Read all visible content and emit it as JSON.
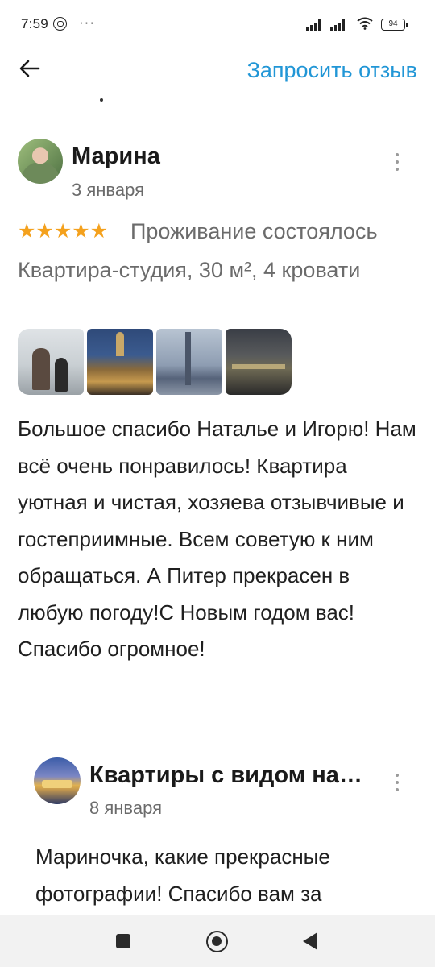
{
  "status_bar": {
    "time": "7:59",
    "dots": "···",
    "battery": "94"
  },
  "app_bar": {
    "back_icon": "back-arrow-icon",
    "action_label": "Запросить отзыв",
    "accent_color": "#2196d6"
  },
  "review": {
    "author": "Марина",
    "date": "3 января",
    "rating_stars": "★★★★★",
    "rating": 5,
    "stay_summary": "Проживание состоялось",
    "apartment": "Квартира-студия, 30 м², 4 кровати",
    "photos": [
      "photo-1",
      "photo-2",
      "photo-3",
      "photo-4"
    ],
    "text": "Большое спасибо Наталье и Игорю! Нам всё очень понравилось! Квартира уютная и чистая, хозяева отзывчивые и гостеприимные. Всем советую к ним обращаться. А Питер прекрасен в любую погоду!С Новым годом вас! Спасибо огромное!"
  },
  "reply": {
    "author": "Квартиры с видом на Неву",
    "date": "8 января",
    "text": "Мариночка, какие прекрасные фотографии! Спасибо вам за"
  },
  "colors": {
    "star": "#f4a11d",
    "secondary_text": "#6b6b6b"
  }
}
